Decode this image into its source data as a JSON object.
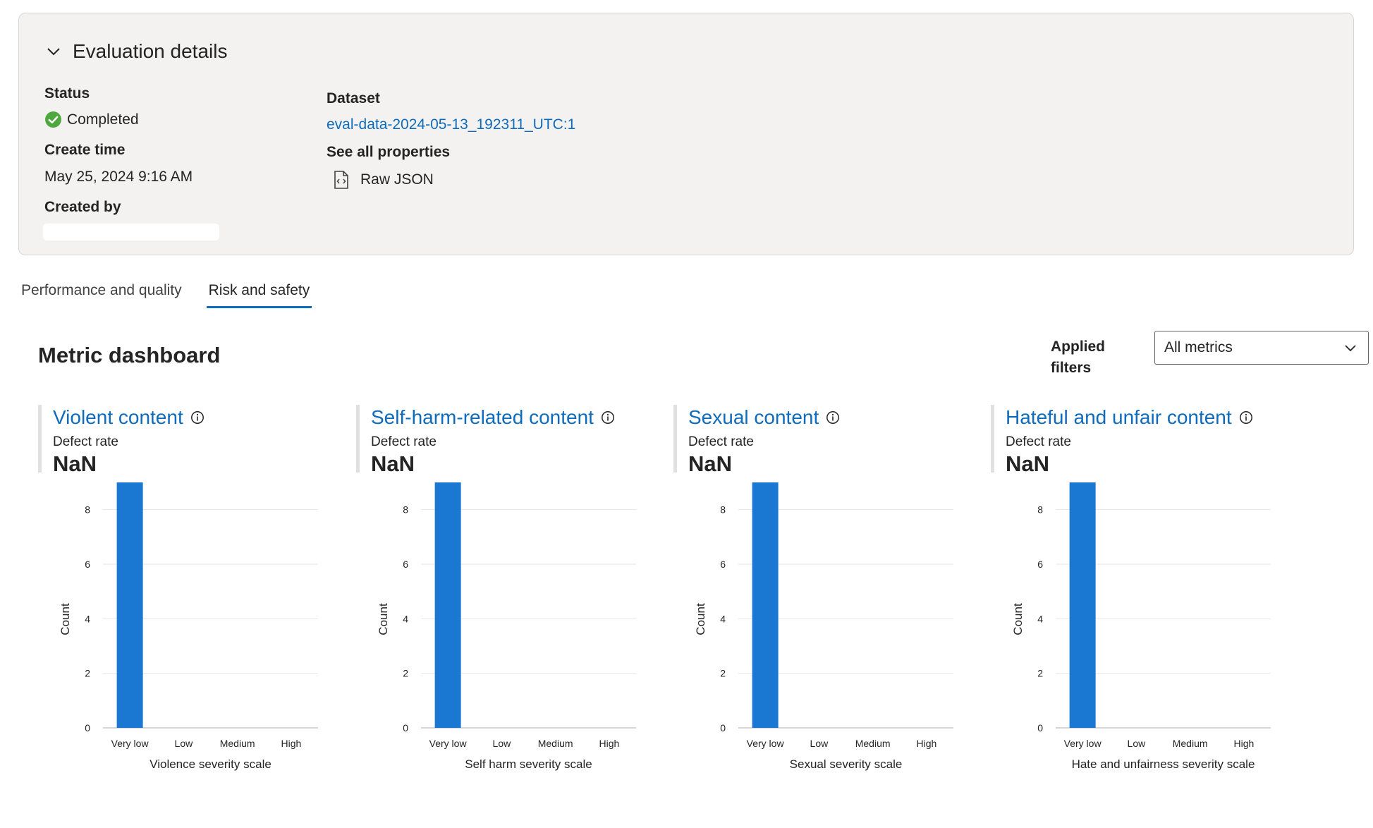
{
  "details": {
    "title": "Evaluation details",
    "status_label": "Status",
    "status_value": "Completed",
    "create_time_label": "Create time",
    "create_time_value": "May 25, 2024 9:16 AM",
    "created_by_label": "Created by",
    "dataset_label": "Dataset",
    "dataset_value": "eval-data-2024-05-13_192311_UTC:1",
    "see_all_label": "See all properties",
    "raw_json_label": "Raw JSON"
  },
  "tabs": [
    {
      "label": "Performance and quality",
      "active": false
    },
    {
      "label": "Risk and safety",
      "active": true
    }
  ],
  "dashboard": {
    "title": "Metric dashboard",
    "filter_label": "Applied filters",
    "filter_value": "All metrics"
  },
  "cards": [
    {
      "title": "Violent content",
      "metric_label": "Defect rate",
      "metric_value": "NaN"
    },
    {
      "title": "Self-harm-related content",
      "metric_label": "Defect rate",
      "metric_value": "NaN"
    },
    {
      "title": "Sexual content",
      "metric_label": "Defect rate",
      "metric_value": "NaN"
    },
    {
      "title": "Hateful and unfair content",
      "metric_label": "Defect rate",
      "metric_value": "NaN"
    }
  ],
  "chart_data": [
    {
      "type": "bar",
      "categories": [
        "Very low",
        "Low",
        "Medium",
        "High"
      ],
      "values": [
        9,
        0,
        0,
        0
      ],
      "xlabel": "Violence severity scale",
      "ylabel": "Count",
      "ylim": [
        0,
        9
      ],
      "yticks": [
        0,
        2,
        4,
        6,
        8
      ],
      "grid": true,
      "color": "#1a78d3"
    },
    {
      "type": "bar",
      "categories": [
        "Very low",
        "Low",
        "Medium",
        "High"
      ],
      "values": [
        9,
        0,
        0,
        0
      ],
      "xlabel": "Self harm severity scale",
      "ylabel": "Count",
      "ylim": [
        0,
        9
      ],
      "yticks": [
        0,
        2,
        4,
        6,
        8
      ],
      "grid": true,
      "color": "#1a78d3"
    },
    {
      "type": "bar",
      "categories": [
        "Very low",
        "Low",
        "Medium",
        "High"
      ],
      "values": [
        9,
        0,
        0,
        0
      ],
      "xlabel": "Sexual severity scale",
      "ylabel": "Count",
      "ylim": [
        0,
        9
      ],
      "yticks": [
        0,
        2,
        4,
        6,
        8
      ],
      "grid": true,
      "color": "#1a78d3"
    },
    {
      "type": "bar",
      "categories": [
        "Very low",
        "Low",
        "Medium",
        "High"
      ],
      "values": [
        9,
        0,
        0,
        0
      ],
      "xlabel": "Hate and unfairness severity scale",
      "ylabel": "Count",
      "ylim": [
        0,
        9
      ],
      "yticks": [
        0,
        2,
        4,
        6,
        8
      ],
      "grid": true,
      "color": "#1a78d3"
    }
  ]
}
